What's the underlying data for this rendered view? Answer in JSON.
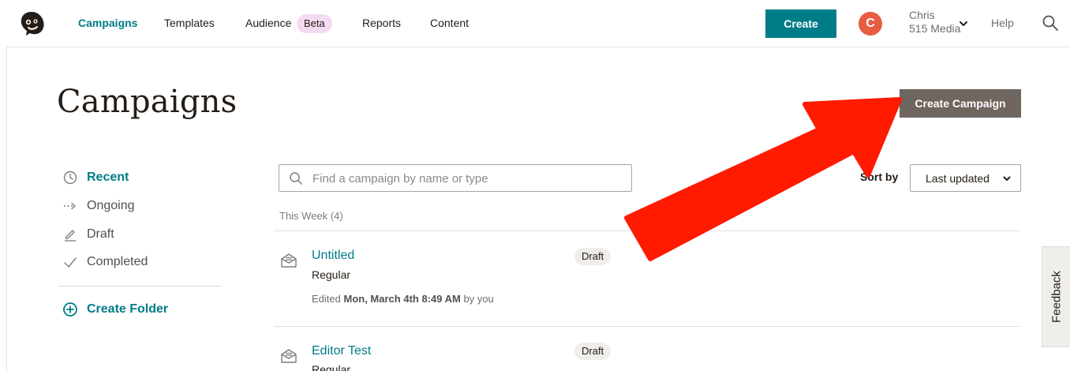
{
  "nav": {
    "items": [
      "Campaigns",
      "Templates",
      "Audience",
      "Reports",
      "Content"
    ],
    "beta_badge": "Beta",
    "create_label": "Create",
    "avatar_initial": "C",
    "account_name": "Chris",
    "account_org": "515 Media",
    "help_label": "Help",
    "accent_color": "#007c89"
  },
  "page": {
    "title": "Campaigns",
    "create_campaign_label": "Create Campaign"
  },
  "sidebar": {
    "items": [
      {
        "label": "Recent",
        "icon": "clock-icon",
        "active": true
      },
      {
        "label": "Ongoing",
        "icon": "dotted-arrow-icon",
        "active": false
      },
      {
        "label": "Draft",
        "icon": "pencil-icon",
        "active": false
      },
      {
        "label": "Completed",
        "icon": "checkmark-icon",
        "active": false
      }
    ],
    "create_folder_label": "Create Folder"
  },
  "search": {
    "placeholder": "Find a campaign by name or type"
  },
  "sort": {
    "label": "Sort by",
    "value": "Last updated"
  },
  "list": {
    "group_heading": "This Week (4)",
    "campaigns": [
      {
        "name": "Untitled",
        "type": "Regular",
        "status": "Draft",
        "edited_prefix": "Edited",
        "edited_date": "Mon, March 4th 8:49 AM",
        "edited_suffix": "by you"
      },
      {
        "name": "Editor Test",
        "type": "Regular",
        "status": "Draft"
      }
    ]
  },
  "feedback_label": "Feedback",
  "annotation": {
    "arrow_color": "#ff1a00"
  }
}
